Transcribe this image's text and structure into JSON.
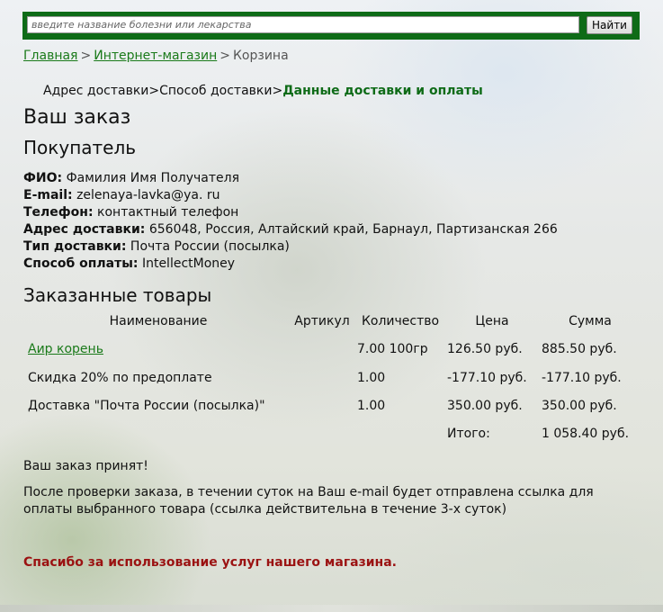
{
  "search": {
    "placeholder": "введите название болезни или лекарства",
    "button_label": "Найти"
  },
  "breadcrumb": {
    "home": "Главная",
    "shop": "Интернет-магазин",
    "current": "Корзина",
    "separator": ">"
  },
  "steps": {
    "step1": "Адрес доставки",
    "step2": "Способ доставки",
    "step3": "Данные доставки и оплаты",
    "separator": ">"
  },
  "order": {
    "title": "Ваш заказ",
    "buyer_heading": "Покупатель",
    "buyer": [
      {
        "label": "ФИО:",
        "value": "Фамилия Имя Получателя"
      },
      {
        "label": "E-mail:",
        "value": "zelenaya-lavka@ya. ru"
      },
      {
        "label": "Телефон:",
        "value": "контактный телефон"
      },
      {
        "label": "Адрес доставки:",
        "value": "656048, Россия, Алтайский край, Барнаул, Партизанская 266"
      },
      {
        "label": "Тип доставки:",
        "value": "Почта России (посылка)"
      },
      {
        "label": "Способ оплаты:",
        "value": "IntellectMoney"
      }
    ]
  },
  "items": {
    "heading": "Заказанные товары",
    "columns": [
      "Наименование",
      "Артикул",
      "Количество",
      "Цена",
      "Сумма"
    ],
    "rows": [
      {
        "name": "Аир корень",
        "article": "",
        "qty": "7.00 100гр",
        "price": "126.50 руб.",
        "sum": "885.50 руб."
      },
      {
        "name": "Скидка 20% по предоплате",
        "article": "",
        "qty": "1.00",
        "price": "-177.10 руб.",
        "sum": "-177.10 руб."
      },
      {
        "name": "Доставка \"Почта России (посылка)\"",
        "article": "",
        "qty": "1.00",
        "price": "350.00 руб.",
        "sum": "350.00 руб."
      }
    ],
    "total_label": "Итого:",
    "total_value": "1 058.40 руб."
  },
  "messages": {
    "accepted": "Ваш заказ принят!",
    "info": "После проверки заказа, в течении суток на Ваш e-mail будет отправлена ссылка для оплаты выбранного товара (ссылка действительна в течение 3-х суток)",
    "thanks": "Спасибо за использование услуг нашего магазина."
  },
  "colors": {
    "brand_green": "#0e6b17",
    "link_green": "#1a7a1a",
    "thanks_red": "#9b1212"
  }
}
